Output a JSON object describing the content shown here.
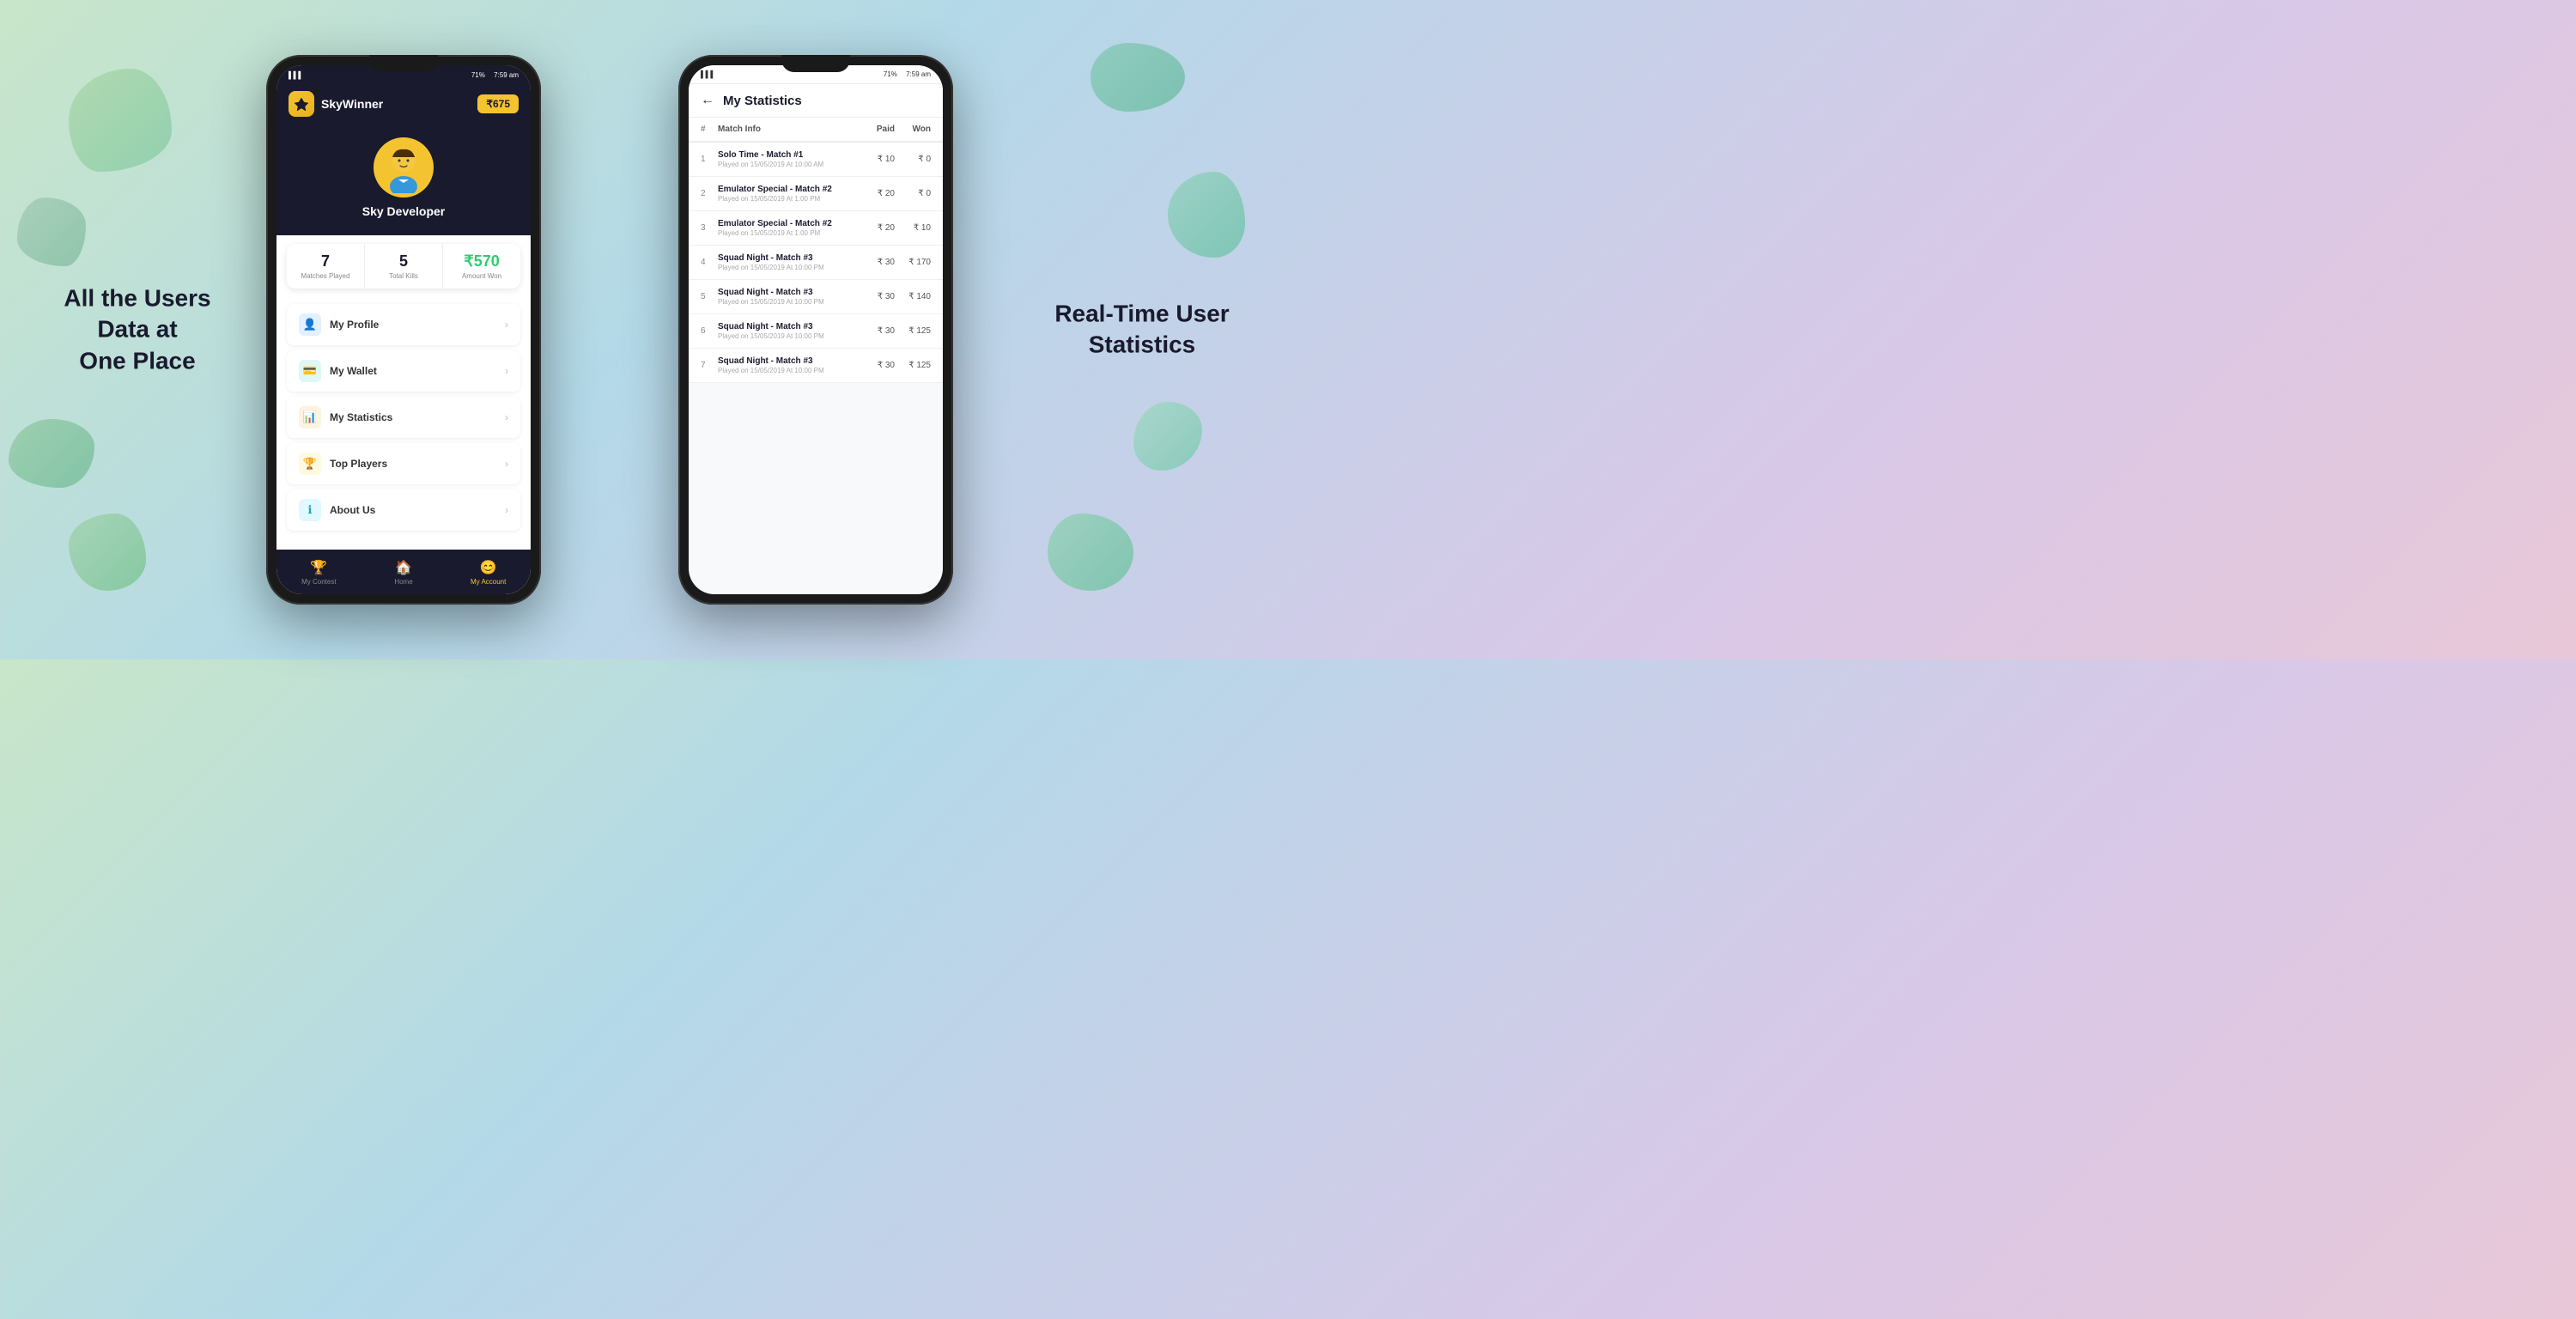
{
  "page": {
    "left_tagline_line1": "All the Users Data at",
    "left_tagline_line2": "One Place",
    "right_tagline_line1": "Real-Time User",
    "right_tagline_line2": "Statistics"
  },
  "phone_left": {
    "status": {
      "signal": "▌▌▌",
      "battery_pct": "71%",
      "time": "7:59 am"
    },
    "header": {
      "app_name": "SkyWinner",
      "wallet_amount": "₹675"
    },
    "user": {
      "name": "Sky Developer"
    },
    "stats": [
      {
        "value": "7",
        "label": "Matches Played"
      },
      {
        "value": "5",
        "label": "Total Kills"
      },
      {
        "value": "₹570",
        "label": "Amount Won"
      }
    ],
    "menu_items": [
      {
        "icon": "👤",
        "icon_type": "blue",
        "label": "My Profile"
      },
      {
        "icon": "💳",
        "icon_type": "teal",
        "label": "My Wallet"
      },
      {
        "icon": "📊",
        "icon_type": "orange",
        "label": "My Statistics"
      },
      {
        "icon": "🏆",
        "icon_type": "yellow",
        "label": "Top Players"
      },
      {
        "icon": "ℹ",
        "icon_type": "cyan",
        "label": "About Us"
      }
    ],
    "nav": [
      {
        "icon": "🏆",
        "label": "My Contest",
        "active": false
      },
      {
        "icon": "🏠",
        "label": "Home",
        "active": false
      },
      {
        "icon": "😊",
        "label": "My Account",
        "active": true
      }
    ]
  },
  "phone_right": {
    "status": {
      "signal": "▌▌▌",
      "battery_pct": "71%",
      "time": "7:59 am"
    },
    "header": {
      "back_label": "←",
      "title": "My Statistics"
    },
    "table": {
      "columns": [
        "#",
        "Match Info",
        "Paid",
        "Won"
      ],
      "rows": [
        {
          "num": "1",
          "match": "Solo Time - Match #1",
          "date": "Played on 15/05/2019 At 10:00 AM",
          "paid": "₹ 10",
          "won": "₹ 0"
        },
        {
          "num": "2",
          "match": "Emulator Special - Match #2",
          "date": "Played on 15/05/2019 At 1:00 PM",
          "paid": "₹ 20",
          "won": "₹ 0"
        },
        {
          "num": "3",
          "match": "Emulator Special - Match #2",
          "date": "Played on 15/05/2019 At 1:00 PM",
          "paid": "₹ 20",
          "won": "₹ 10"
        },
        {
          "num": "4",
          "match": "Squad Night - Match #3",
          "date": "Played on 15/05/2019 At 10:00 PM",
          "paid": "₹ 30",
          "won": "₹ 170"
        },
        {
          "num": "5",
          "match": "Squad Night - Match #3",
          "date": "Played on 15/05/2019 At 10:00 PM",
          "paid": "₹ 30",
          "won": "₹ 140"
        },
        {
          "num": "6",
          "match": "Squad Night - Match #3",
          "date": "Played on 15/05/2019 At 10:00 PM",
          "paid": "₹ 30",
          "won": "₹ 125"
        },
        {
          "num": "7",
          "match": "Squad Night - Match #3",
          "date": "Played on 15/05/2019 At 10:00 PM",
          "paid": "₹ 30",
          "won": "₹ 125"
        }
      ]
    }
  }
}
